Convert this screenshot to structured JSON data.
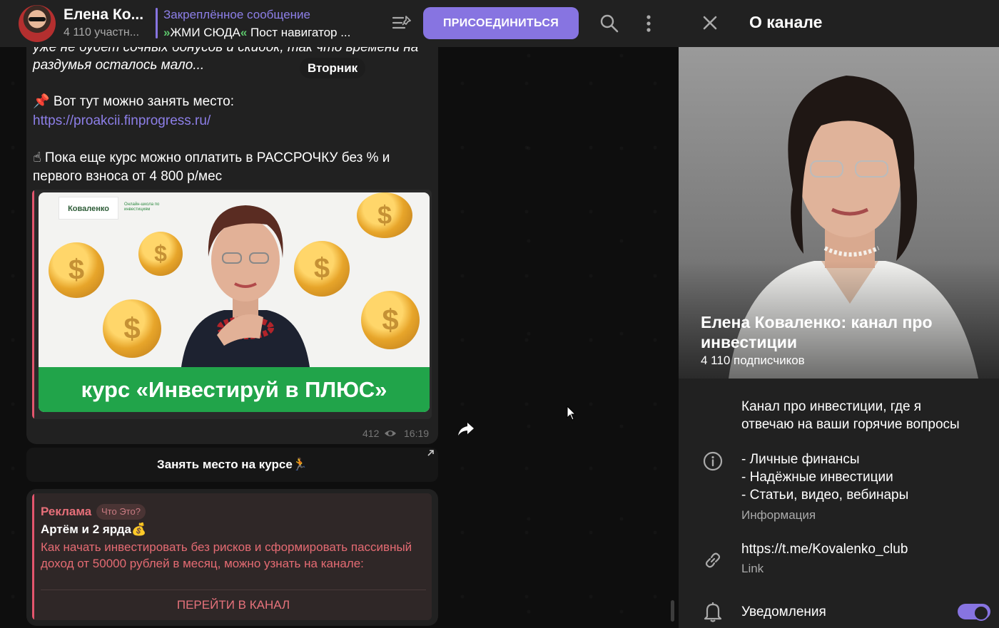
{
  "header": {
    "channel_title": "Елена Ко...",
    "members": "4 110 участн...",
    "pinned_title": "Закреплённое сообщение",
    "pinned_chev_left": "»",
    "pinned_cta": "ЖМИ СЮДА",
    "pinned_chev_right": "«",
    "pinned_rest": " Пост навигатор ...",
    "join_label": "ПРИСОЕДИНИТЬСЯ"
  },
  "message": {
    "line_cut": "уже не будет сочных бонусов и скидок, так что времени на",
    "line_cut2": "раздумья осталось мало...",
    "date_pill": "Вторник",
    "place_line": "📌 Вот тут можно занять место:",
    "link": "https://proakcii.finprogress.ru/",
    "installment": "☝ Пока еще курс можно оплатить в РАССРОЧКУ без % и первого взноса от 4 800 р/мес",
    "banner_logo": "Коваленко",
    "banner_logo_note": "Онлайн-школа по инвестициям",
    "banner_cta": "курс «Инвестируй в ПЛЮС»",
    "views": "412",
    "time": "16:19",
    "inline_button": "Занять место на курсе🏃"
  },
  "ad": {
    "label": "Реклама",
    "what": "Что Это?",
    "name": "Артём и 2 ярда💰",
    "text": "Как начать инвестировать без рисков и сформировать пассивный доход от 50000 рублей в месяц, можно узнать на канале:",
    "button": "ПЕРЕЙТИ В КАНАЛ"
  },
  "panel": {
    "title": "О канале",
    "name": "Елена Коваленко: канал про инвестиции",
    "subscribers": "4 110 подписчиков",
    "about_1": "Канал про инвестиции, где я",
    "about_2": "отвечаю на ваши горячие вопросы",
    "about_3": "- Личные финансы",
    "about_4": "- Надёжные инвестиции",
    "about_5": "- Статьи, видео, вебинары",
    "about_caption": "Информация",
    "link": "https://t.me/Kovalenko_club",
    "link_caption": "Link",
    "notifications": "Уведомления",
    "notifications_on": true
  },
  "colors": {
    "accent": "#8774e1",
    "ad_red": "#e56b73",
    "banner_green": "#21a44a"
  },
  "icons": [
    "pinned-list-icon",
    "search-icon",
    "more-icon",
    "eye-icon",
    "share-icon",
    "external-link-icon",
    "close-icon",
    "info-icon",
    "link-icon",
    "bell-icon",
    "cursor-icon"
  ]
}
